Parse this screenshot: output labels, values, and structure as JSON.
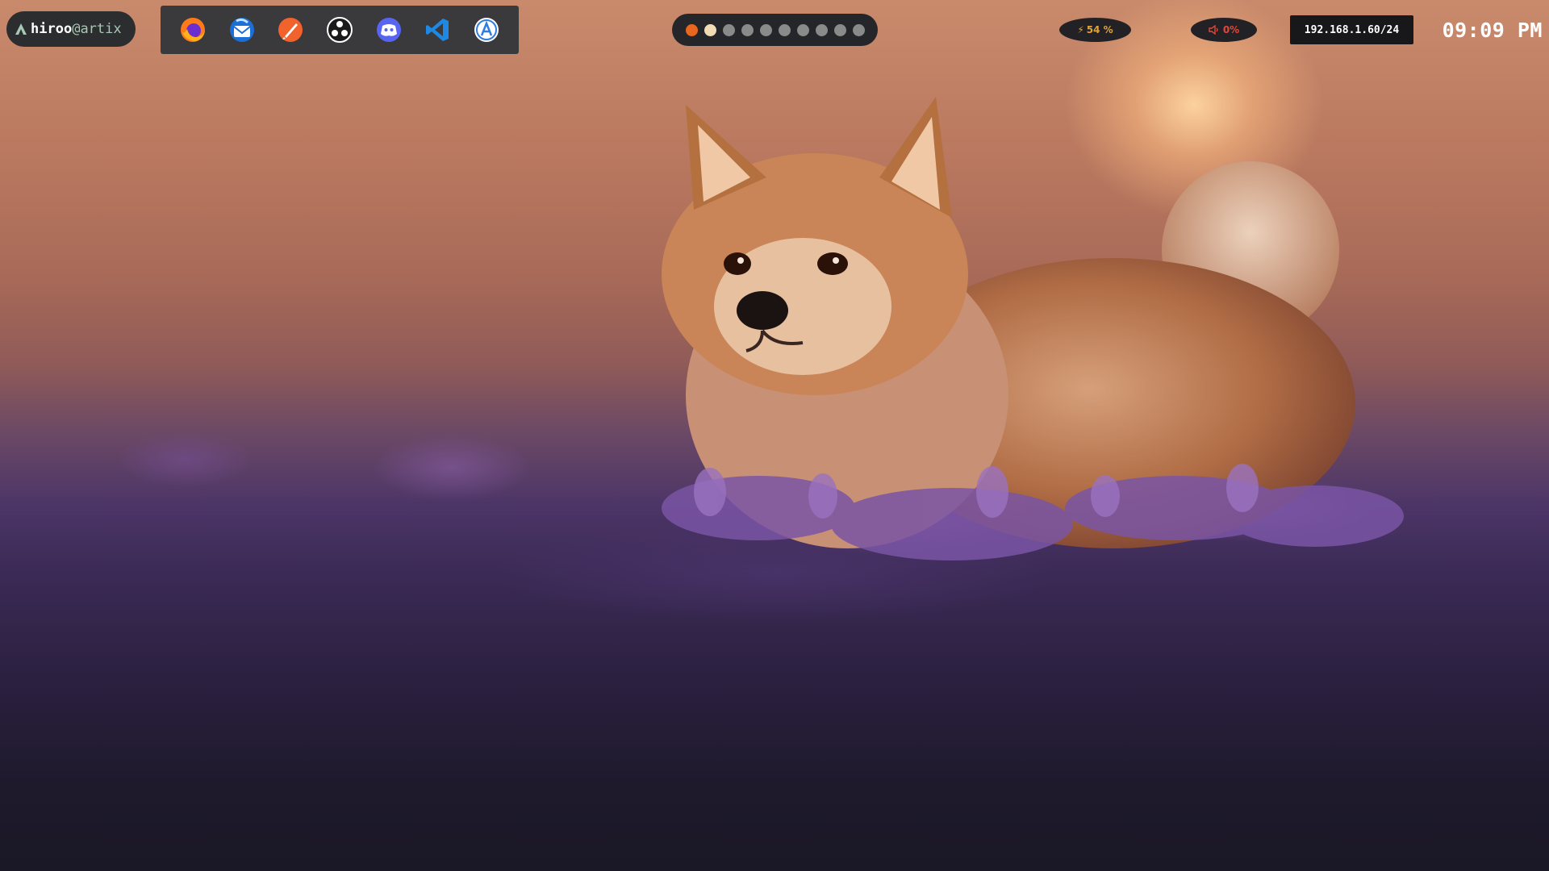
{
  "user": {
    "username": "hiroo",
    "separator": "@",
    "hostname": "artix",
    "logo": "artix-logo-icon"
  },
  "dock": {
    "apps": [
      {
        "name": "Firefox",
        "icon": "firefox-icon"
      },
      {
        "name": "Thunderbird",
        "icon": "thunderbird-icon"
      },
      {
        "name": "Inkscape",
        "icon": "inkscape-icon"
      },
      {
        "name": "OBS Studio",
        "icon": "obs-icon"
      },
      {
        "name": "Discord",
        "icon": "discord-icon"
      },
      {
        "name": "Visual Studio Code",
        "icon": "vscode-icon"
      },
      {
        "name": "App Store",
        "icon": "appstore-icon"
      }
    ]
  },
  "workspaces": {
    "count": 10,
    "active_index": 0,
    "focused_index": 1
  },
  "status": {
    "battery": {
      "value": "54 %",
      "icon": "bolt-icon",
      "color": "#e0a33c"
    },
    "volume": {
      "value": "0%",
      "icon": "speaker-icon",
      "color": "#e1483a"
    },
    "network": {
      "value": "192.168.1.60/24"
    },
    "clock": {
      "value": "09:09 PM"
    }
  },
  "colors": {
    "workspace_active": "#e9661e",
    "workspace_focused": "#f1ddb3",
    "workspace_idle": "#8a8a8a"
  }
}
